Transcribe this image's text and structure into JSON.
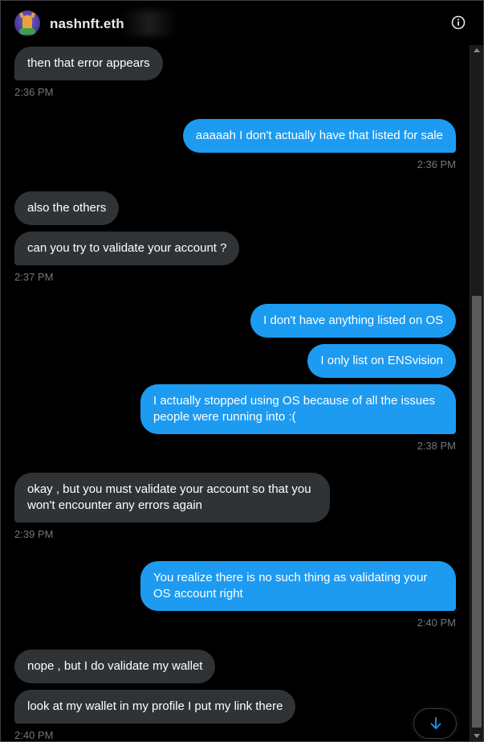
{
  "header": {
    "contact_name": "nashnft.eth",
    "info_icon": "info-circle-icon",
    "avatar_icon": "fox-avatar"
  },
  "messages": [
    {
      "side": "in",
      "text": "then that error appears",
      "tail": true
    },
    {
      "side": "in",
      "time": "2:36 PM"
    },
    {
      "side": "out",
      "text": "aaaaah I don't actually have that listed for sale",
      "tail": true
    },
    {
      "side": "out",
      "time": "2:36 PM"
    },
    {
      "side": "in",
      "text": "also the others"
    },
    {
      "side": "in",
      "text": "can you try to validate your account ?",
      "tail": true
    },
    {
      "side": "in",
      "time": "2:37 PM"
    },
    {
      "side": "out",
      "text": "I don't have anything listed on OS"
    },
    {
      "side": "out",
      "text": "I only list on ENSvision"
    },
    {
      "side": "out",
      "text": "I actually stopped using OS because of all the issues people were running into :(",
      "tail": true
    },
    {
      "side": "out",
      "time": "2:38 PM"
    },
    {
      "side": "in",
      "text": "okay , but you must validate your account so that you won't encounter any errors again",
      "tail": true
    },
    {
      "side": "in",
      "time": "2:39 PM"
    },
    {
      "side": "out",
      "text": "You realize there is no such thing as validating your OS account right",
      "tail": true
    },
    {
      "side": "out",
      "time": "2:40 PM"
    },
    {
      "side": "in",
      "text": "nope , but I do validate my wallet"
    },
    {
      "side": "in",
      "text": "look at my wallet in my profile I put my link there",
      "tail": true
    },
    {
      "side": "in",
      "time": "2:40 PM"
    }
  ],
  "scroll_down_icon": "arrow-down-icon",
  "colors": {
    "incoming_bubble": "#2f3336",
    "outgoing_bubble": "#1d9bf0",
    "timestamp": "#71767b",
    "background": "#000000"
  }
}
